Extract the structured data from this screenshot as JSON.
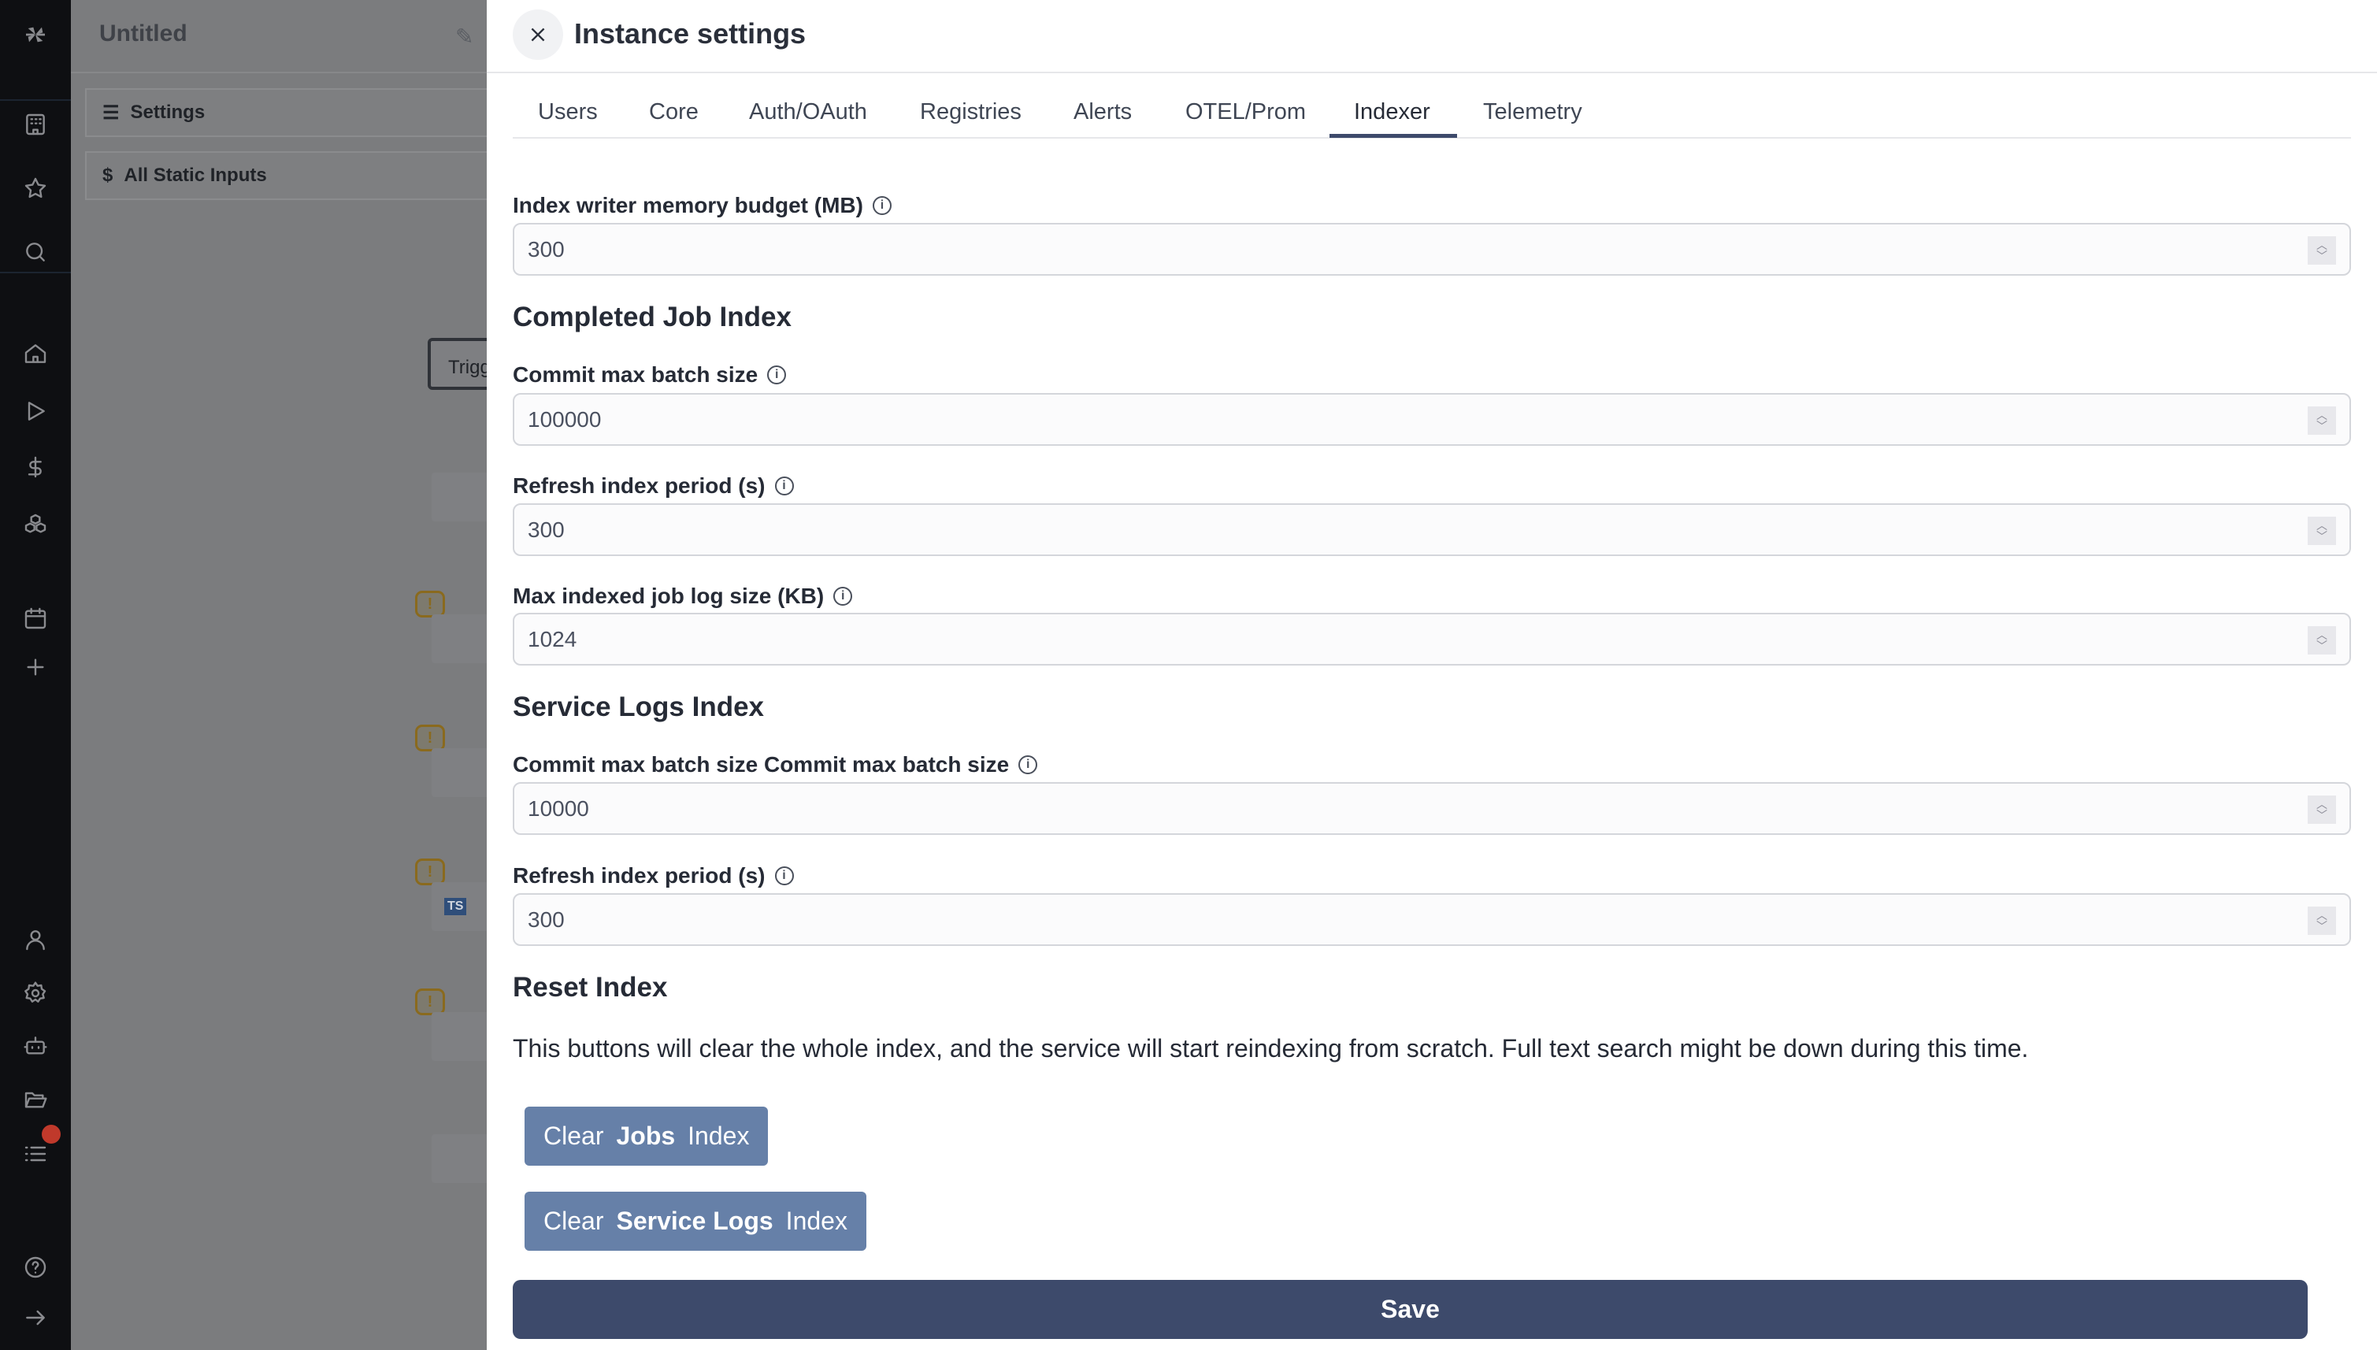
{
  "background": {
    "flow_title": "Untitled",
    "settings_label": "Settings",
    "static_inputs_label": "All Static Inputs",
    "trigger_label": "Trigg",
    "node_badges": [
      "TS"
    ]
  },
  "modal": {
    "title": "Instance settings",
    "tabs": [
      {
        "label": "Users"
      },
      {
        "label": "Core"
      },
      {
        "label": "Auth/OAuth"
      },
      {
        "label": "Registries"
      },
      {
        "label": "Alerts"
      },
      {
        "label": "OTEL/Prom"
      },
      {
        "label": "Indexer",
        "active": true
      },
      {
        "label": "Telemetry"
      }
    ],
    "fields": {
      "memory_budget": {
        "label": "Index writer memory budget (MB)",
        "value": "300"
      },
      "completed_heading": "Completed Job Index",
      "job_batch": {
        "label": "Commit max batch size",
        "value": "100000"
      },
      "job_refresh": {
        "label": "Refresh index period (s)",
        "value": "300"
      },
      "job_log_size": {
        "label": "Max indexed job log size (KB)",
        "value": "1024"
      },
      "service_heading": "Service Logs Index",
      "svc_batch": {
        "label": "Commit max batch size Commit max batch size",
        "value": "10000"
      },
      "svc_refresh": {
        "label": "Refresh index period (s)",
        "value": "300"
      }
    },
    "reset": {
      "heading": "Reset Index",
      "description": "This buttons will clear the whole index, and the service will start reindexing from scratch. Full text search might be down during this time.",
      "clear_jobs": {
        "prefix": "Clear",
        "bold": "Jobs",
        "suffix": "Index"
      },
      "clear_logs": {
        "prefix": "Clear",
        "bold": "Service Logs",
        "suffix": "Index"
      }
    },
    "save_label": "Save"
  },
  "colors": {
    "primary": "#3d4a6b",
    "secondary_button": "#6680a8",
    "sidebar": "#0e0f12",
    "notification": "#c0392b"
  }
}
